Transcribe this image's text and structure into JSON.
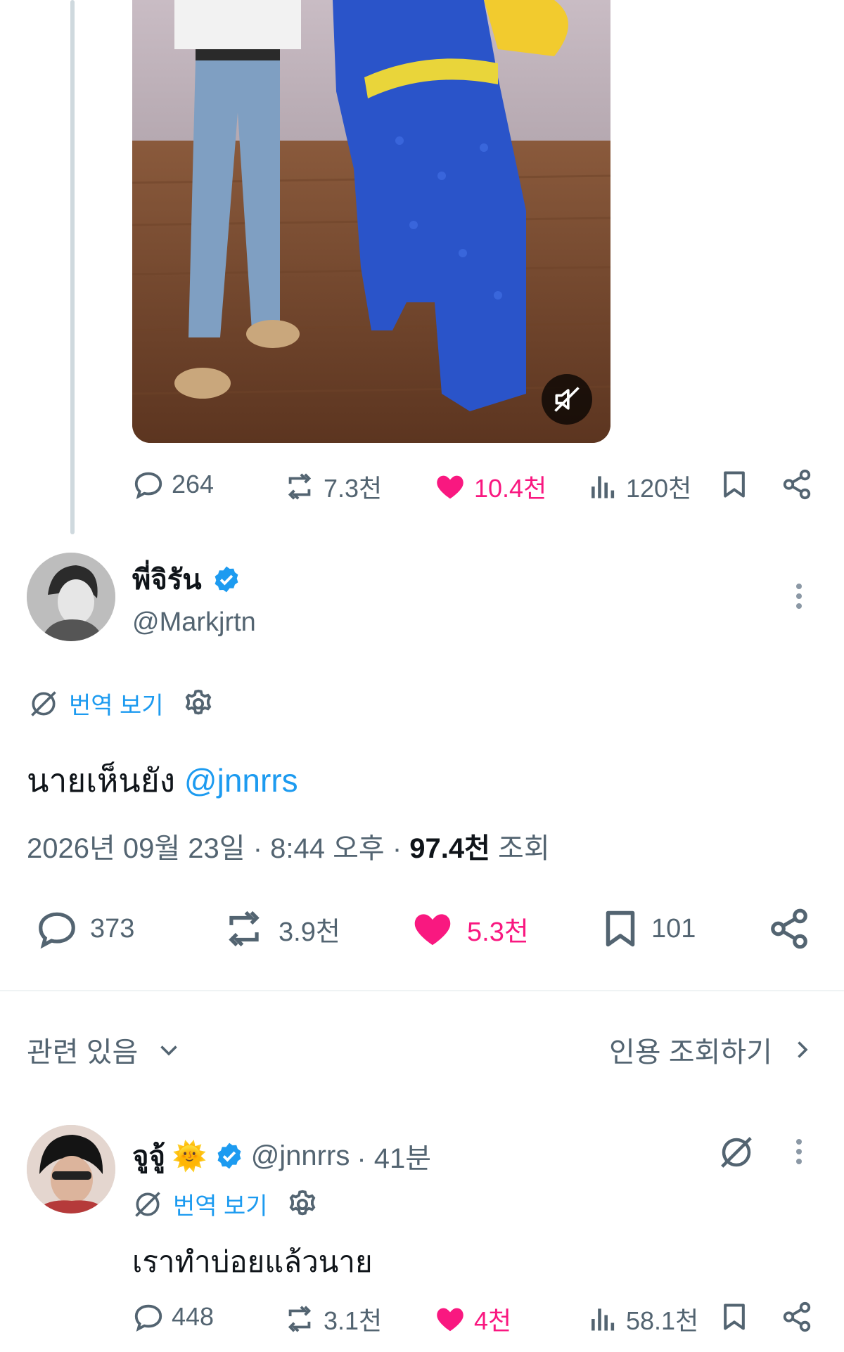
{
  "top_post": {
    "stats": {
      "replies": "264",
      "reposts": "7.3천",
      "likes": "10.4천",
      "views": "120천"
    }
  },
  "main_post": {
    "display_name": "พี่จิรัน",
    "handle": "@Markjrtn",
    "translate_label": "번역 보기",
    "text_main": "นายเห็นยัง",
    "text_mention": "@jnnrrs",
    "date": "2026년 09월 23일 · 8:44 오후 · ",
    "views_count": "97.4천",
    "views_label": " 조회",
    "stats": {
      "replies": "373",
      "reposts": "3.9천",
      "likes": "5.3천",
      "bookmarks": "101"
    }
  },
  "related": {
    "label": "관련 있음",
    "quotes_label": "인용 조회하기"
  },
  "reply_post": {
    "display_name": "จูจู้",
    "emoji": "🌞",
    "handle": "@jnnrrs",
    "time": " · 41분",
    "translate_label": "번역 보기",
    "text": "เราทำบ่อยแล้วนาย",
    "stats": {
      "replies": "448",
      "reposts": "3.1천",
      "likes": "4천",
      "views": "58.1천"
    }
  },
  "colors": {
    "like": "#f91880",
    "link": "#1d9bf0",
    "muted": "#536471",
    "text": "#0f1419"
  }
}
